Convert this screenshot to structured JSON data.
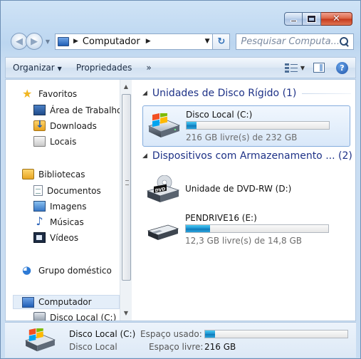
{
  "address": {
    "location": "Computador"
  },
  "search": {
    "placeholder": "Pesquisar Computa..."
  },
  "toolbar": {
    "organize": "Organizar",
    "properties": "Propriedades",
    "more": "»"
  },
  "nav": {
    "favorites": "Favoritos",
    "desktop": "Área de Trabalho",
    "downloads": "Downloads",
    "places": "Locais",
    "libraries": "Bibliotecas",
    "documents": "Documentos",
    "images": "Imagens",
    "music": "Músicas",
    "videos": "Vídeos",
    "homegroup": "Grupo doméstico",
    "computer": "Computador",
    "local_disk": "Disco Local (C:)"
  },
  "groups": {
    "hdd_header": "Unidades de Disco Rígido (1)",
    "removable_header": "Dispositivos com Armazenamento ... (2)"
  },
  "drives": [
    {
      "name": "Disco Local (C:)",
      "space": "216 GB livre(s) de 232 GB",
      "used_fraction": 0.07
    },
    {
      "name": "Unidade de DVD-RW (D:)",
      "badge": "DVD"
    },
    {
      "name": "PENDRIVE16 (E:)",
      "space": "12,3 GB livre(s) de 14,8 GB",
      "used_fraction": 0.17
    }
  ],
  "details": {
    "name": "Disco Local (C:)",
    "type": "Disco Local",
    "used_label": "Espaço usado:",
    "free_label": "Espaço livre:",
    "free_value": "216 GB",
    "used_fraction": 0.07
  },
  "icons": {
    "back": "back-arrow-icon",
    "forward": "forward-arrow-icon",
    "refresh": "refresh-icon",
    "search": "search-icon",
    "help": "help-icon"
  },
  "colors": {
    "accent": "#1e3287",
    "bar_fill": "#1a8fce",
    "selection": "#d9e8f9"
  }
}
